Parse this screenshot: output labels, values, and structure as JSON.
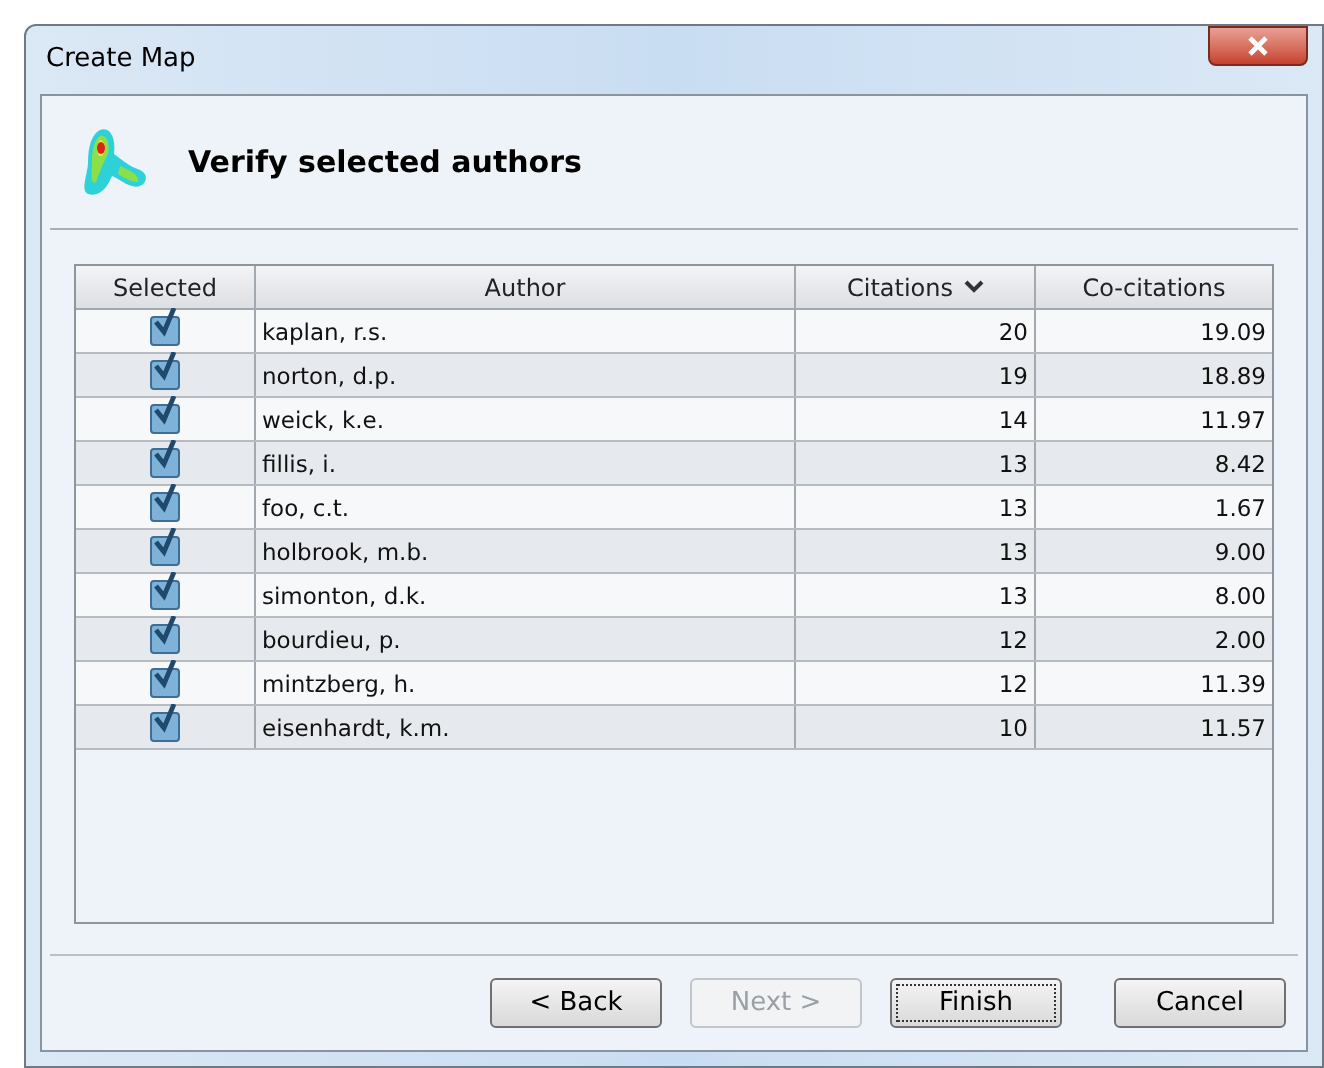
{
  "window": {
    "title": "Create Map"
  },
  "header": {
    "title": "Verify selected authors"
  },
  "table": {
    "columns": [
      {
        "label": "Selected",
        "sorted": false
      },
      {
        "label": "Author",
        "sorted": false
      },
      {
        "label": "Citations",
        "sorted": true
      },
      {
        "label": "Co-citations",
        "sorted": false
      }
    ],
    "rows": [
      {
        "checked": true,
        "author": "kaplan, r.s.",
        "citations": "20",
        "co_citations": "19.09"
      },
      {
        "checked": true,
        "author": "norton, d.p.",
        "citations": "19",
        "co_citations": "18.89"
      },
      {
        "checked": true,
        "author": "weick, k.e.",
        "citations": "14",
        "co_citations": "11.97"
      },
      {
        "checked": true,
        "author": "fillis, i.",
        "citations": "13",
        "co_citations": "8.42"
      },
      {
        "checked": true,
        "author": "foo, c.t.",
        "citations": "13",
        "co_citations": "1.67"
      },
      {
        "checked": true,
        "author": "holbrook, m.b.",
        "citations": "13",
        "co_citations": "9.00"
      },
      {
        "checked": true,
        "author": "simonton, d.k.",
        "citations": "13",
        "co_citations": "8.00"
      },
      {
        "checked": true,
        "author": "bourdieu, p.",
        "citations": "12",
        "co_citations": "2.00"
      },
      {
        "checked": true,
        "author": "mintzberg, h.",
        "citations": "12",
        "co_citations": "11.39"
      },
      {
        "checked": true,
        "author": "eisenhardt, k.m.",
        "citations": "10",
        "co_citations": "11.57"
      }
    ]
  },
  "buttons": [
    {
      "label": "< Back",
      "disabled": false,
      "focused": false
    },
    {
      "label": "Next >",
      "disabled": true,
      "focused": false
    },
    {
      "label": "Finish",
      "disabled": false,
      "focused": true
    },
    {
      "label": "Cancel",
      "disabled": false,
      "focused": false
    }
  ]
}
